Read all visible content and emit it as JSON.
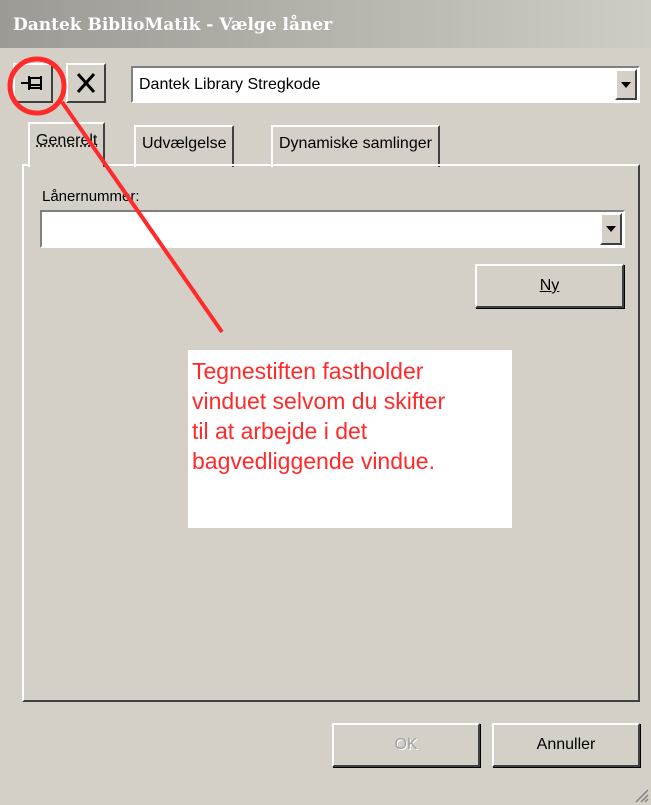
{
  "window": {
    "title": "Dantek BiblioMatik - Vælge låner"
  },
  "toolbar": {
    "pin_icon": "pushpin-icon",
    "close_icon": "close-x-icon",
    "database_combo_value": "Dantek Library Stregkode"
  },
  "tabs": [
    {
      "label": "Generelt",
      "active": true
    },
    {
      "label": "Udvælgelse",
      "active": false
    },
    {
      "label": "Dynamiske samlinger",
      "active": false
    }
  ],
  "form": {
    "borrower_label": "Lånernummer:",
    "borrower_value": "",
    "new_button_label": "Ny"
  },
  "annotation": {
    "line1": "Tegnestiften fastholder",
    "line2": "vinduet selvom du skifter",
    "line3": "til at arbejde i det",
    "line4": "bagvedliggende vindue.",
    "color": "#ff2a2a"
  },
  "footer": {
    "ok_label": "OK",
    "ok_enabled": false,
    "cancel_label": "Annuller"
  }
}
